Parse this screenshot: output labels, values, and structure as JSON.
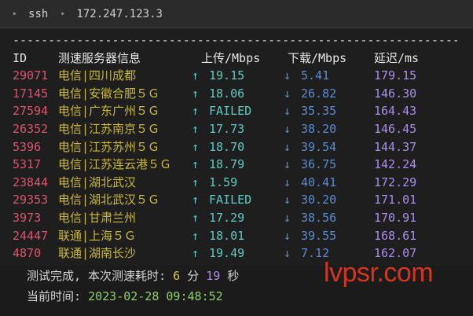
{
  "tab": {
    "chevron": "▸",
    "segments": [
      "ssh",
      "172.247.123.3"
    ]
  },
  "terminal": {
    "dashes": "------------------------------------------------------------------------------------------------",
    "header": {
      "id": "ID",
      "node": "测速服务器信息",
      "up": "上传/Mbps",
      "down": "下载/Mbps",
      "latency": "延迟/ms"
    },
    "rows": [
      {
        "id": "29071",
        "node": "电信|四川成都",
        "up": "19.15",
        "down": "5.41",
        "latency": "179.15"
      },
      {
        "id": "17145",
        "node": "电信|安徽合肥５Ｇ",
        "up": "18.06",
        "down": "26.82",
        "latency": "146.30"
      },
      {
        "id": "27594",
        "node": "电信|广东广州５Ｇ",
        "up": "FAILED",
        "down": "35.35",
        "latency": "164.43"
      },
      {
        "id": "26352",
        "node": "电信|江苏南京５Ｇ",
        "up": "17.73",
        "down": "38.20",
        "latency": "146.45"
      },
      {
        "id": "5396",
        "node": "电信|江苏苏州５Ｇ",
        "up": "18.70",
        "down": "39.54",
        "latency": "144.37"
      },
      {
        "id": "5317",
        "node": "电信|江苏连云港５Ｇ",
        "up": "18.79",
        "down": "36.75",
        "latency": "142.24"
      },
      {
        "id": "23844",
        "node": "电信|湖北武汉",
        "up": "1.59",
        "down": "40.41",
        "latency": "172.29"
      },
      {
        "id": "29353",
        "node": "电信|湖北武汉５Ｇ",
        "up": "FAILED",
        "down": "30.20",
        "latency": "171.01"
      },
      {
        "id": "3973",
        "node": "电信|甘肃兰州",
        "up": "17.29",
        "down": "38.56",
        "latency": "170.91"
      },
      {
        "id": "24447",
        "node": "联通|上海５Ｇ",
        "up": "18.01",
        "down": "39.55",
        "latency": "168.61"
      },
      {
        "id": "4870",
        "node": "联通|湖南长沙",
        "up": "19.49",
        "down": "7.12",
        "latency": "162.07"
      }
    ],
    "up_arrow": "↑",
    "down_arrow": "↓"
  },
  "footer": {
    "done_prefix": "测试完成, 本次测速耗时: ",
    "minutes": "6",
    "min_unit": " 分 ",
    "seconds": "19",
    "sec_unit": " 秒",
    "time_label": "当前时间: ",
    "time_value": "2023-02-28 09:48:52"
  },
  "watermark": "lvpsr.com",
  "colors": {
    "id": "#d9546e",
    "node": "#c9b83a",
    "upload": "#5fc9c0",
    "download": "#5b8bd1",
    "latency": "#a88ee8",
    "watermark": "#e4381f"
  }
}
